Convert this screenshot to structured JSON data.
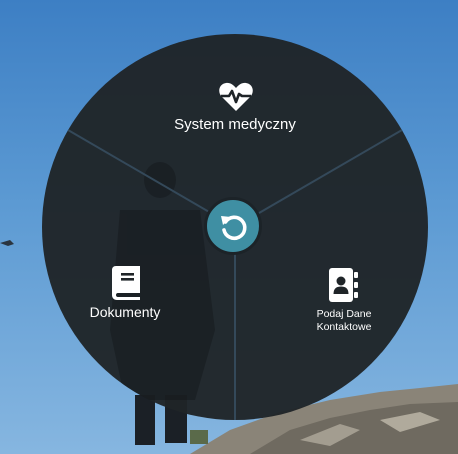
{
  "radial_menu": {
    "segments": [
      {
        "id": "medical",
        "label": "System medyczny",
        "icon": "heartbeat-icon"
      },
      {
        "id": "documents",
        "label": "Dokumenty",
        "icon": "book-icon"
      },
      {
        "id": "contact",
        "label": "Podaj Dane Kontaktowe",
        "icon": "address-book-icon"
      }
    ],
    "center": {
      "icon": "undo-icon"
    }
  },
  "colors": {
    "wheel_fill": "#1f2428",
    "divider": "#34495a",
    "center_button": "#3f8fa3",
    "sky": "#5c9ad3",
    "text": "#ffffff"
  }
}
